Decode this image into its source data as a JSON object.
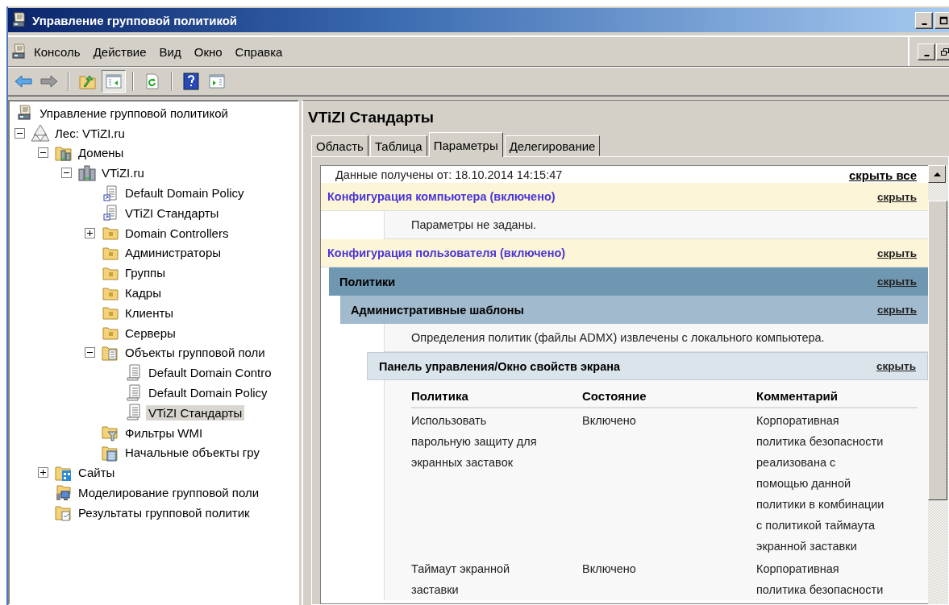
{
  "window": {
    "title": "Управление групповой политикой"
  },
  "menu": [
    "Консоль",
    "Действие",
    "Вид",
    "Окно",
    "Справка"
  ],
  "toolbar": [
    [
      {
        "kind": "back",
        "pressed": false
      },
      {
        "kind": "forward",
        "pressed": false
      }
    ],
    [
      {
        "kind": "up",
        "pressed": false
      },
      {
        "kind": "show-tree",
        "pressed": true
      }
    ],
    [
      {
        "kind": "refresh",
        "pressed": false
      }
    ],
    [
      {
        "kind": "help",
        "pressed": false
      },
      {
        "kind": "action-pane",
        "pressed": false
      }
    ]
  ],
  "tree": [
    {
      "label": "Управление групповой политикой",
      "kind": "console",
      "selected": false,
      "children": [
        {
          "label": "Лес: VTiZI.ru",
          "kind": "forest",
          "selected": false,
          "expanded": true,
          "children": [
            {
              "label": "Домены",
              "kind": "domains",
              "selected": false,
              "expanded": true,
              "children": [
                {
                  "label": "VTiZI.ru",
                  "kind": "domain",
                  "selected": false,
                  "expanded": true,
                  "children": [
                    {
                      "label": "Default Domain Policy",
                      "kind": "gpo-link",
                      "selected": false
                    },
                    {
                      "label": "VTiZI Стандарты",
                      "kind": "gpo-link",
                      "selected": false
                    },
                    {
                      "label": "Domain Controllers",
                      "kind": "ou",
                      "selected": false,
                      "expanded": false
                    },
                    {
                      "label": "Администраторы",
                      "kind": "ou",
                      "selected": false
                    },
                    {
                      "label": "Группы",
                      "kind": "ou",
                      "selected": false
                    },
                    {
                      "label": "Кадры",
                      "kind": "ou",
                      "selected": false
                    },
                    {
                      "label": "Клиенты",
                      "kind": "ou",
                      "selected": false
                    },
                    {
                      "label": "Серверы",
                      "kind": "ou",
                      "selected": false
                    },
                    {
                      "label": "Объекты групповой поли",
                      "kind": "gpo-folder",
                      "selected": false,
                      "expanded": true,
                      "children": [
                        {
                          "label": "Default Domain Contro",
                          "kind": "gpo",
                          "selected": false
                        },
                        {
                          "label": "Default Domain Policy",
                          "kind": "gpo",
                          "selected": false
                        },
                        {
                          "label": "VTiZI Стандарты",
                          "kind": "gpo",
                          "selected": true
                        }
                      ]
                    },
                    {
                      "label": "Фильтры WMI",
                      "kind": "wmi",
                      "selected": false
                    },
                    {
                      "label": "Начальные объекты гру",
                      "kind": "starter",
                      "selected": false
                    }
                  ]
                }
              ]
            },
            {
              "label": "Сайты",
              "kind": "sites",
              "selected": false,
              "expanded": false
            },
            {
              "label": "Моделирование групповой поли",
              "kind": "modeling",
              "selected": false
            },
            {
              "label": "Результаты групповой политик",
              "kind": "results",
              "selected": false
            }
          ]
        }
      ]
    }
  ],
  "details": {
    "title": "VTiZI Стандарты",
    "tabs": [
      {
        "label": "Область",
        "selected": false
      },
      {
        "label": "Таблица",
        "selected": false
      },
      {
        "label": "Параметры",
        "selected": true
      },
      {
        "label": "Делегирование",
        "selected": false
      }
    ],
    "received": "Данные получены от: 18.10.2014 14:15:47",
    "hide_all": "скрыть все",
    "sections": [
      {
        "kind": "config",
        "title": "Конфигурация компьютера (включено)",
        "hide": "скрыть",
        "children": [
          {
            "kind": "message",
            "text": "Параметры не заданы."
          }
        ]
      },
      {
        "kind": "config",
        "title": "Конфигурация пользователя (включено)",
        "hide": "скрыть",
        "children": [
          {
            "kind": "policies",
            "title": "Политики",
            "hide": "скрыть",
            "children": [
              {
                "kind": "templates",
                "title": "Административные шаблоны",
                "hide": "скрыть",
                "children": [
                  {
                    "kind": "message",
                    "text": "Определения политик (файлы ADMX) извлечены с локального компьютера."
                  },
                  {
                    "kind": "category",
                    "title": "Панель управления/Окно свойств экрана",
                    "hide": "скрыть",
                    "table": {
                      "columns": [
                        "Политика",
                        "Состояние",
                        "Комментарий"
                      ],
                      "rows": [
                        [
                          "Использовать\nпарольную защиту для\nэкранных заставок",
                          "Включено",
                          "Корпоративная\nполитика безопасности\nреализована с\nпомощью данной\nполитики в комбинации\nс политикой таймаута\nэкранной заставки"
                        ],
                        [
                          "Таймаут экранной\nзаставки",
                          "Включено",
                          "Корпоративная\nполитика безопасности"
                        ]
                      ]
                    }
                  }
                ]
              }
            ]
          }
        ]
      }
    ]
  }
}
